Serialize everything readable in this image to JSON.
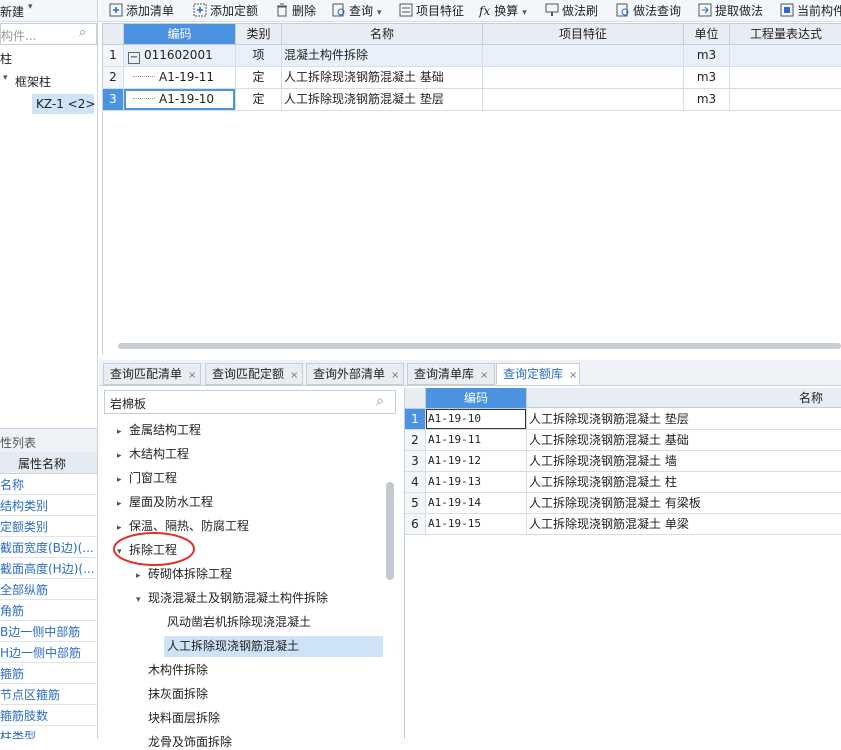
{
  "left": {
    "new_label": "新建",
    "search_placeholder": "构件...",
    "tree_root": "柱",
    "tree_child": "框架柱",
    "tree_item": "KZ-1 <2>",
    "attr_header": "性列表",
    "attr_col": "属性名称",
    "attr_rows": [
      "名称",
      "结构类别",
      "定额类别",
      "截面宽度(B边)(...",
      "截面高度(H边)(...",
      "全部纵筋",
      "角筋",
      "B边一侧中部筋",
      "H边一侧中部筋",
      "箍筋",
      "节点区箍筋",
      "箍筋肢数",
      "柱类型"
    ]
  },
  "toolbar": {
    "items": [
      "添加清单",
      "添加定额",
      "删除",
      "查询",
      "项目特征",
      "换算",
      "做法刷",
      "做法查询",
      "提取做法",
      "当前构件"
    ]
  },
  "grid": {
    "headers": [
      "编码",
      "类别",
      "名称",
      "项目特征",
      "单位",
      "工程量表达式"
    ],
    "rows": [
      {
        "num": "1",
        "code": "011602001",
        "type": "项",
        "name": "混凝土构件拆除",
        "unit": "m3"
      },
      {
        "num": "2",
        "code": "A1-19-11",
        "type": "定",
        "name": "人工拆除现浇钢筋混凝土 基础",
        "unit": "m3"
      },
      {
        "num": "3",
        "code": "A1-19-10",
        "type": "定",
        "name": "人工拆除现浇钢筋混凝土 垫层",
        "unit": "m3"
      }
    ]
  },
  "tabs": [
    "查询匹配清单",
    "查询匹配定额",
    "查询外部清单",
    "查询清单库",
    "查询定额库"
  ],
  "query": {
    "search_value": "岩棉板",
    "tree": [
      {
        "label": "金属结构工程",
        "level": 0,
        "arrow": "▸"
      },
      {
        "label": "木结构工程",
        "level": 0,
        "arrow": "▸"
      },
      {
        "label": "门窗工程",
        "level": 0,
        "arrow": "▸"
      },
      {
        "label": "屋面及防水工程",
        "level": 0,
        "arrow": "▸"
      },
      {
        "label": "保温、隔热、防腐工程",
        "level": 0,
        "arrow": "▸"
      },
      {
        "label": "拆除工程",
        "level": 0,
        "arrow": "▾"
      },
      {
        "label": "砖砌体拆除工程",
        "level": 1,
        "arrow": "▸"
      },
      {
        "label": "现浇混凝土及钢筋混凝土构件拆除",
        "level": 1,
        "arrow": "▾"
      },
      {
        "label": "风动凿岩机拆除现浇混凝土",
        "level": 2,
        "arrow": ""
      },
      {
        "label": "人工拆除现浇钢筋混凝土",
        "level": 2,
        "arrow": ""
      },
      {
        "label": "木构件拆除",
        "level": 1,
        "arrow": ""
      },
      {
        "label": "抹灰面拆除",
        "level": 1,
        "arrow": ""
      },
      {
        "label": "块料面层拆除",
        "level": 1,
        "arrow": ""
      },
      {
        "label": "龙骨及饰面拆除",
        "level": 1,
        "arrow": ""
      }
    ],
    "headers": [
      "编码",
      "名称"
    ],
    "rows": [
      {
        "num": "1",
        "code": "A1-19-10",
        "name": "人工拆除现浇钢筋混凝土 垫层"
      },
      {
        "num": "2",
        "code": "A1-19-11",
        "name": "人工拆除现浇钢筋混凝土 基础"
      },
      {
        "num": "3",
        "code": "A1-19-12",
        "name": "人工拆除现浇钢筋混凝土 墙"
      },
      {
        "num": "4",
        "code": "A1-19-13",
        "name": "人工拆除现浇钢筋混凝土 柱"
      },
      {
        "num": "5",
        "code": "A1-19-14",
        "name": "人工拆除现浇钢筋混凝土 有梁板"
      },
      {
        "num": "6",
        "code": "A1-19-15",
        "name": "人工拆除现浇钢筋混凝土 单梁"
      }
    ]
  },
  "colors": {
    "accent": "#4b93e0",
    "highlight_circle": "#e0302a",
    "link": "#2b6cc4"
  }
}
